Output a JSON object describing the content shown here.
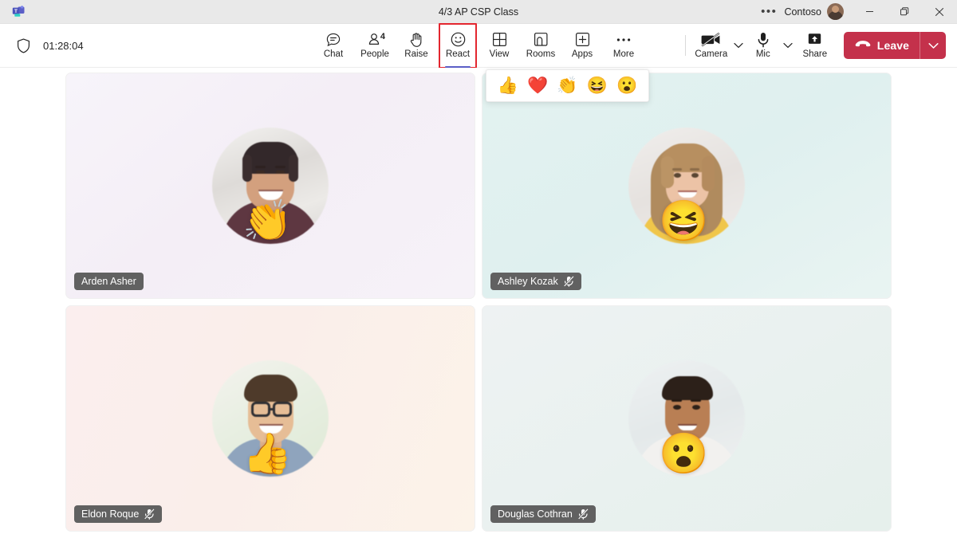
{
  "titlebar": {
    "app_icon": "teams-logo-icon",
    "title": "4/3 AP CSP Class",
    "more_label": "•••",
    "org": "Contoso",
    "avatar": "user-avatar",
    "minimize": "minimize-icon",
    "maximize": "maximize-icon",
    "close": "close-icon"
  },
  "toolbar": {
    "shield_icon": "shield-icon",
    "timer": "01:28:04",
    "buttons": [
      {
        "label": "Chat",
        "icon": "chat-icon",
        "badge": "",
        "active": false
      },
      {
        "label": "People",
        "icon": "people-icon",
        "badge": "4",
        "active": false
      },
      {
        "label": "Raise",
        "icon": "raise-hand-icon",
        "badge": "",
        "active": false
      },
      {
        "label": "React",
        "icon": "react-smiley-icon",
        "badge": "",
        "active": true
      },
      {
        "label": "View",
        "icon": "view-grid-icon",
        "badge": "",
        "active": false
      },
      {
        "label": "Rooms",
        "icon": "rooms-icon",
        "badge": "",
        "active": false
      },
      {
        "label": "Apps",
        "icon": "apps-plus-icon",
        "badge": "",
        "active": false
      },
      {
        "label": "More",
        "icon": "more-ellipsis-icon",
        "badge": "",
        "active": false
      }
    ],
    "camera": {
      "label": "Camera",
      "icon": "camera-off-icon",
      "state": "off"
    },
    "mic": {
      "label": "Mic",
      "icon": "mic-icon",
      "state": "on"
    },
    "share": {
      "label": "Share",
      "icon": "share-screen-icon"
    },
    "leave": {
      "label": "Leave",
      "icon": "hang-up-icon",
      "color": "#c4314b"
    },
    "highlight_color": "#e3262f",
    "active_underline_color": "#5b5fc7"
  },
  "react_popup": {
    "visible": true,
    "reactions": [
      {
        "name": "thumbs-up-reaction",
        "emoji": "👍"
      },
      {
        "name": "heart-reaction",
        "emoji": "❤️"
      },
      {
        "name": "applause-reaction",
        "emoji": "👏"
      },
      {
        "name": "laugh-reaction",
        "emoji": "😆"
      },
      {
        "name": "surprised-reaction",
        "emoji": "😮"
      }
    ]
  },
  "participants": [
    {
      "name": "Arden Asher",
      "muted": false,
      "reaction": "👏",
      "reaction_name": "applause-reaction"
    },
    {
      "name": "Ashley Kozak",
      "muted": true,
      "reaction": "😆",
      "reaction_name": "laugh-reaction"
    },
    {
      "name": "Eldon Roque",
      "muted": true,
      "reaction": "👍",
      "reaction_name": "thumbs-up-reaction"
    },
    {
      "name": "Douglas Cothran",
      "muted": true,
      "reaction": "😮",
      "reaction_name": "surprised-reaction"
    }
  ]
}
